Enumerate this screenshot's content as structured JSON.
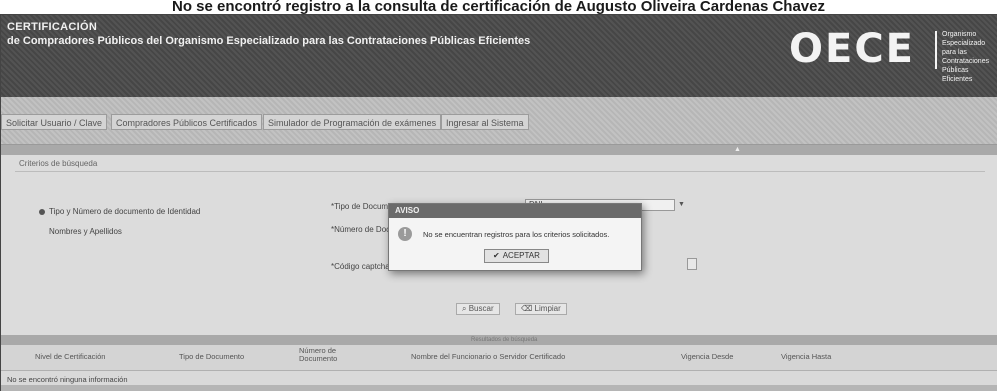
{
  "caption": "No se encontró registro a la consulta de certificación de Augusto Oliveira Cardenas Chavez",
  "header": {
    "line1": "CERTIFICACIÓN",
    "line2": "de Compradores Públicos del Organismo Especializado para las Contrataciones Públicas Eficientes",
    "logo_text": "OECE",
    "logo_sub": "Organismo Especializado para las Contrataciones Públicas Eficientes"
  },
  "menu": [
    "Solicitar Usuario / Clave",
    "Compradores Públicos Certificados",
    "Simulador de Programación de exámenes",
    "Ingresar al Sistema"
  ],
  "criteria": {
    "title": "Criterios de búsqueda",
    "option_doc": "Tipo y Número de documento de Identidad",
    "option_names": "Nombres y Apellidos",
    "doc_type_label": "*Tipo de Documento",
    "doc_type_value": "DNI",
    "doc_number_label": "*Número de Documento",
    "captcha_label": "*Código captcha"
  },
  "buttons": {
    "search": "Buscar",
    "clear": "Limpiar"
  },
  "dialog": {
    "title": "AVISO",
    "icon": "!",
    "message": "No se encuentran registros para los criterios solicitados.",
    "accept": "ACEPTAR"
  },
  "results": {
    "bar_label": "Resultados de búsqueda",
    "headers": [
      "Nivel de Certificación",
      "Tipo de Documento",
      "Número de Documento",
      "Nombre del Funcionario o Servidor Certificado",
      "Vigencia Desde",
      "Vigencia Hasta"
    ],
    "empty": "No se encontró ninguna información"
  },
  "colors": {
    "banner": "#4a4a4a",
    "menubar": "#bdbdbd",
    "content": "#dcdcdc",
    "dialog_header": "#6a6a6a"
  }
}
